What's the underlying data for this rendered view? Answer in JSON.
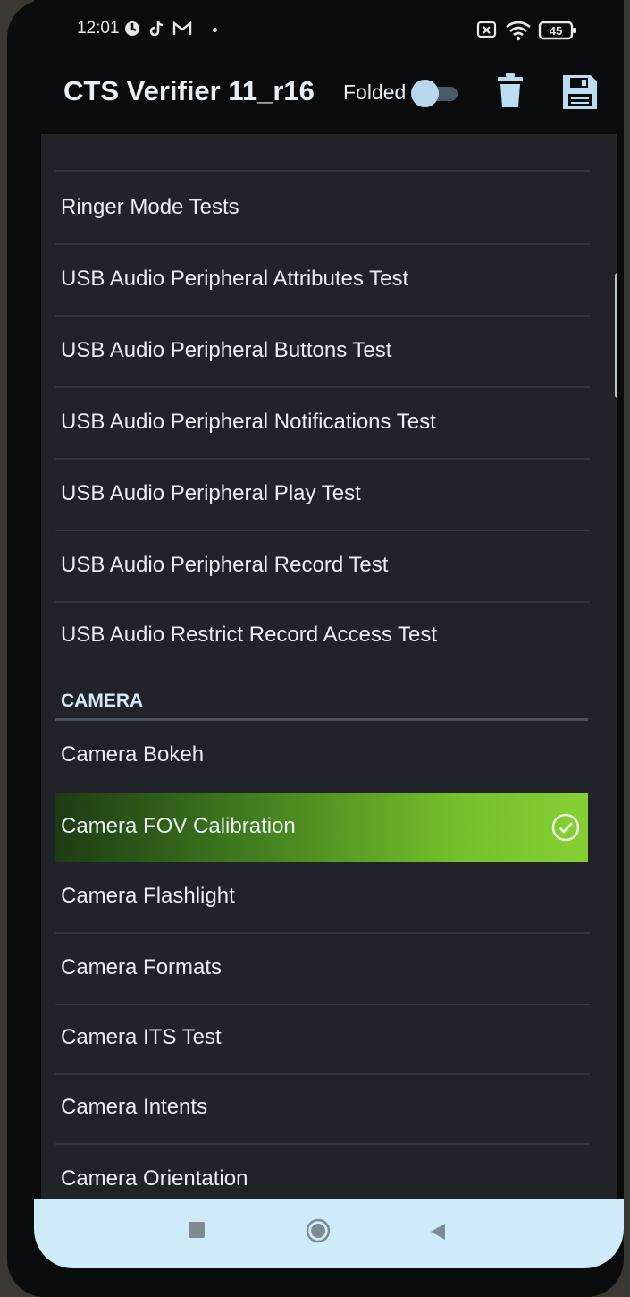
{
  "status_bar": {
    "time": "12:01",
    "battery": "45"
  },
  "app_bar": {
    "title": "CTS Verifier 11_r16",
    "folded_label": "Folded"
  },
  "list": {
    "items_before": [
      {
        "label": "Ringer Mode Tests"
      },
      {
        "label": "USB Audio Peripheral Attributes Test"
      },
      {
        "label": "USB Audio Peripheral Buttons Test"
      },
      {
        "label": "USB Audio Peripheral Notifications Test"
      },
      {
        "label": "USB Audio Peripheral Play Test"
      },
      {
        "label": "USB Audio Peripheral Record Test"
      },
      {
        "label": "USB Audio Restrict Record Access Test"
      }
    ],
    "section": "CAMERA",
    "items_after": [
      {
        "label": "Camera Bokeh",
        "status": "none"
      },
      {
        "label": "Camera FOV Calibration",
        "status": "passed"
      },
      {
        "label": "Camera Flashlight",
        "status": "none"
      },
      {
        "label": "Camera Formats",
        "status": "none"
      },
      {
        "label": "Camera ITS Test",
        "status": "none"
      },
      {
        "label": "Camera Intents",
        "status": "none"
      },
      {
        "label": "Camera Orientation",
        "status": "none"
      }
    ]
  },
  "colors": {
    "passed_gradient_end": "#86d035",
    "list_background": "#202428",
    "nav_bar": "#cfeaf8"
  },
  "icons": {
    "trash": "trash-icon",
    "save": "save-icon",
    "check": "check-circle-icon"
  }
}
